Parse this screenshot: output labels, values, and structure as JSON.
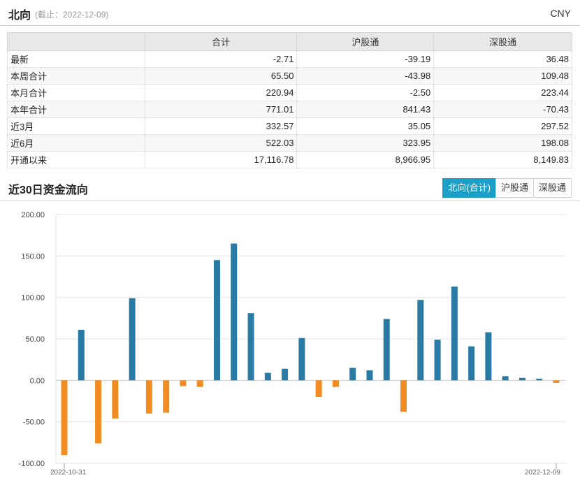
{
  "header": {
    "title": "北向",
    "date": "(截止：2022-12-09)",
    "currency": "CNY"
  },
  "table": {
    "columns": [
      "",
      "合计",
      "沪股通",
      "深股通"
    ],
    "rows": [
      {
        "label": "最新",
        "values": [
          "-2.71",
          "-39.19",
          "36.48"
        ]
      },
      {
        "label": "本周合计",
        "values": [
          "65.50",
          "-43.98",
          "109.48"
        ]
      },
      {
        "label": "本月合计",
        "values": [
          "220.94",
          "-2.50",
          "223.44"
        ]
      },
      {
        "label": "本年合计",
        "values": [
          "771.01",
          "841.43",
          "-70.43"
        ]
      },
      {
        "label": "近3月",
        "values": [
          "332.57",
          "35.05",
          "297.52"
        ]
      },
      {
        "label": "近6月",
        "values": [
          "522.03",
          "323.95",
          "198.08"
        ]
      },
      {
        "label": "开通以来",
        "values": [
          "17,116.78",
          "8,966.95",
          "8,149.83"
        ]
      }
    ]
  },
  "section": {
    "title": "近30日资金流向"
  },
  "tabs": [
    {
      "label": "北向(合计)",
      "active": true
    },
    {
      "label": "沪股通",
      "active": false
    },
    {
      "label": "深股通",
      "active": false
    }
  ],
  "colors": {
    "positive": "#2a7aa6",
    "negative": "#f18c22",
    "accent": "#1ca0c8"
  },
  "chart_data": {
    "type": "bar",
    "title": "",
    "xlabel": "",
    "ylabel": "",
    "ylim": [
      -100,
      200
    ],
    "yticks": [
      "200.00",
      "150.00",
      "100.00",
      "50.00",
      "0.00",
      "-50.00",
      "-100.00"
    ],
    "grid": true,
    "x_start_label": "2022-10-31",
    "x_end_label": "2022-12-09",
    "values": [
      -90,
      61,
      -76,
      -46,
      99,
      -40,
      -39,
      -7,
      -8,
      145,
      165,
      81,
      9,
      14,
      51,
      -20,
      -8,
      15,
      12,
      74,
      -38,
      97,
      49,
      113,
      41,
      58,
      5,
      3,
      2,
      -3
    ]
  }
}
